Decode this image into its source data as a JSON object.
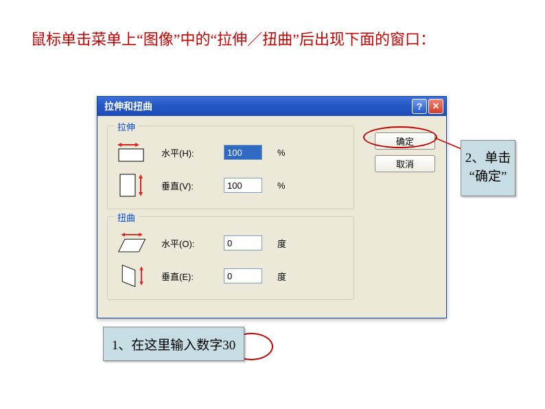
{
  "instruction": "鼠标单击菜单上“图像”中的“拉伸／扭曲”后出现下面的窗口：",
  "dialog": {
    "title": "拉伸和扭曲",
    "help_glyph": "?",
    "close_glyph": "✕",
    "stretch": {
      "legend": "拉伸",
      "h_label": "水平(H):",
      "h_value": "100",
      "h_unit": "%",
      "v_label": "垂直(V):",
      "v_value": "100",
      "v_unit": "%"
    },
    "skew": {
      "legend": "扭曲",
      "h_label": "水平(O):",
      "h_value": "0",
      "h_unit": "度",
      "v_label": "垂直(E):",
      "v_value": "0",
      "v_unit": "度"
    },
    "ok_label": "确定",
    "cancel_label": "取消"
  },
  "callouts": {
    "step1": "1、在这里输入数字30",
    "step2": "2、单击\n“确定”"
  }
}
